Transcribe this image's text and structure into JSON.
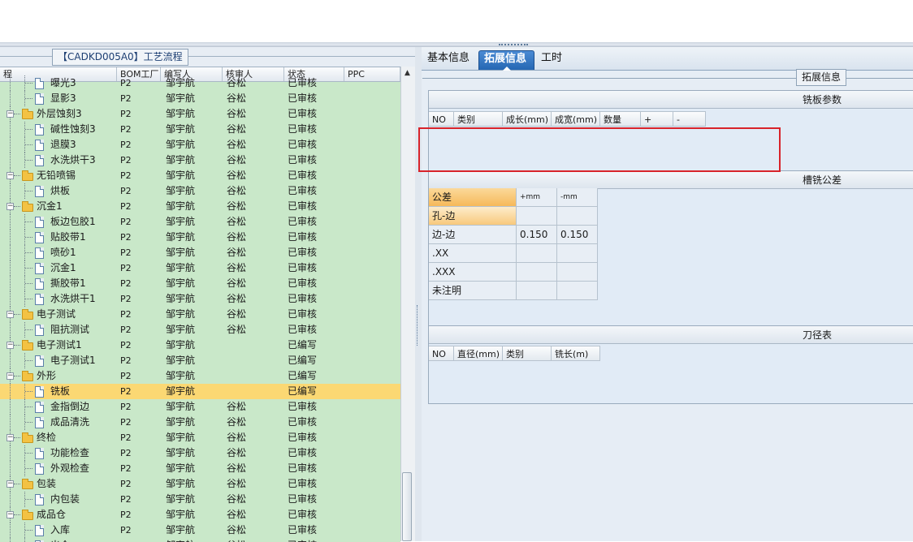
{
  "left_panel": {
    "title": "【CADKD005A0】工艺流程",
    "columns": [
      "程",
      "BOM工厂",
      "编写人",
      "核审人",
      "状态",
      "PPC"
    ]
  },
  "tree_rows": [
    {
      "name": "曝光3",
      "level": 2,
      "bom": "P2",
      "author": "邹宇航",
      "reviewer": "谷松",
      "status": "已审核"
    },
    {
      "name": "显影3",
      "level": 2,
      "bom": "P2",
      "author": "邹宇航",
      "reviewer": "谷松",
      "status": "已审核"
    },
    {
      "name": "外层蚀刻3",
      "level": 1,
      "bom": "P2",
      "author": "邹宇航",
      "reviewer": "谷松",
      "status": "已审核"
    },
    {
      "name": "碱性蚀刻3",
      "level": 2,
      "bom": "P2",
      "author": "邹宇航",
      "reviewer": "谷松",
      "status": "已审核"
    },
    {
      "name": "退膜3",
      "level": 2,
      "bom": "P2",
      "author": "邹宇航",
      "reviewer": "谷松",
      "status": "已审核"
    },
    {
      "name": "水洗烘干3",
      "level": 2,
      "bom": "P2",
      "author": "邹宇航",
      "reviewer": "谷松",
      "status": "已审核"
    },
    {
      "name": "无铅喷锡",
      "level": 1,
      "bom": "P2",
      "author": "邹宇航",
      "reviewer": "谷松",
      "status": "已审核"
    },
    {
      "name": "烘板",
      "level": 2,
      "bom": "P2",
      "author": "邹宇航",
      "reviewer": "谷松",
      "status": "已审核"
    },
    {
      "name": "沉金1",
      "level": 1,
      "bom": "P2",
      "author": "邹宇航",
      "reviewer": "谷松",
      "status": "已审核"
    },
    {
      "name": "板边包胶1",
      "level": 2,
      "bom": "P2",
      "author": "邹宇航",
      "reviewer": "谷松",
      "status": "已审核"
    },
    {
      "name": "贴胶带1",
      "level": 2,
      "bom": "P2",
      "author": "邹宇航",
      "reviewer": "谷松",
      "status": "已审核"
    },
    {
      "name": "喷砂1",
      "level": 2,
      "bom": "P2",
      "author": "邹宇航",
      "reviewer": "谷松",
      "status": "已审核"
    },
    {
      "name": "沉金1",
      "level": 2,
      "bom": "P2",
      "author": "邹宇航",
      "reviewer": "谷松",
      "status": "已审核"
    },
    {
      "name": "撕胶带1",
      "level": 2,
      "bom": "P2",
      "author": "邹宇航",
      "reviewer": "谷松",
      "status": "已审核"
    },
    {
      "name": "水洗烘干1",
      "level": 2,
      "bom": "P2",
      "author": "邹宇航",
      "reviewer": "谷松",
      "status": "已审核"
    },
    {
      "name": "电子测试",
      "level": 1,
      "bom": "P2",
      "author": "邹宇航",
      "reviewer": "谷松",
      "status": "已审核"
    },
    {
      "name": "阻抗测试",
      "level": 2,
      "bom": "P2",
      "author": "邹宇航",
      "reviewer": "谷松",
      "status": "已审核"
    },
    {
      "name": "电子测试1",
      "level": 1,
      "bom": "P2",
      "author": "邹宇航",
      "reviewer": "",
      "status": "已编写"
    },
    {
      "name": "电子测试1",
      "level": 2,
      "bom": "P2",
      "author": "邹宇航",
      "reviewer": "",
      "status": "已编写"
    },
    {
      "name": "外形",
      "level": 1,
      "bom": "P2",
      "author": "邹宇航",
      "reviewer": "",
      "status": "已编写"
    },
    {
      "name": "铣板",
      "level": 2,
      "bom": "P2",
      "author": "邹宇航",
      "reviewer": "",
      "status": "已编写",
      "selected": true
    },
    {
      "name": "金指倒边",
      "level": 2,
      "bom": "P2",
      "author": "邹宇航",
      "reviewer": "谷松",
      "status": "已审核"
    },
    {
      "name": "成品清洗",
      "level": 2,
      "bom": "P2",
      "author": "邹宇航",
      "reviewer": "谷松",
      "status": "已审核"
    },
    {
      "name": "终检",
      "level": 1,
      "bom": "P2",
      "author": "邹宇航",
      "reviewer": "谷松",
      "status": "已审核"
    },
    {
      "name": "功能检查",
      "level": 2,
      "bom": "P2",
      "author": "邹宇航",
      "reviewer": "谷松",
      "status": "已审核"
    },
    {
      "name": "外观检查",
      "level": 2,
      "bom": "P2",
      "author": "邹宇航",
      "reviewer": "谷松",
      "status": "已审核"
    },
    {
      "name": "包装",
      "level": 1,
      "bom": "P2",
      "author": "邹宇航",
      "reviewer": "谷松",
      "status": "已审核"
    },
    {
      "name": "内包装",
      "level": 2,
      "bom": "P2",
      "author": "邹宇航",
      "reviewer": "谷松",
      "status": "已审核"
    },
    {
      "name": "成品仓",
      "level": 1,
      "bom": "P2",
      "author": "邹宇航",
      "reviewer": "谷松",
      "status": "已审核"
    },
    {
      "name": "入库",
      "level": 2,
      "bom": "P2",
      "author": "邹宇航",
      "reviewer": "谷松",
      "status": "已审核"
    },
    {
      "name": "出仓",
      "level": 2,
      "bom": "P2",
      "author": "邹宇航",
      "reviewer": "谷松",
      "status": "已审核"
    }
  ],
  "tabs": [
    {
      "label": "基本信息",
      "active": false
    },
    {
      "label": "拓展信息",
      "active": true
    },
    {
      "label": "工时",
      "active": false
    }
  ],
  "group_label": "拓展信息",
  "mill_params": {
    "title": "铣板参数",
    "columns": [
      "NO",
      "类别",
      "成长(mm)",
      "成宽(mm)",
      "数量",
      "+",
      "-"
    ]
  },
  "slot_tolerance": {
    "title": "槽铣公差",
    "header": [
      "公差",
      "+mm",
      "-mm"
    ],
    "rows": [
      {
        "label": "孔-边",
        "plus": "",
        "minus": ""
      },
      {
        "label": "边-边",
        "plus": "0.150",
        "minus": "0.150"
      },
      {
        "label": ".XX",
        "plus": "",
        "minus": ""
      },
      {
        "label": ".XXX",
        "plus": "",
        "minus": ""
      },
      {
        "label": "未注明",
        "plus": "",
        "minus": ""
      }
    ]
  },
  "cutter_table": {
    "title": "刀径表",
    "columns": [
      "NO",
      "直径(mm)",
      "类别",
      "铣长(m)"
    ]
  },
  "colors": {
    "grid_green": "#c9e8c9",
    "selected_row": "#fbd873",
    "active_tab": "#2f74c3",
    "highlight_red": "#d8232a",
    "header_orange": "#f6b95a"
  }
}
